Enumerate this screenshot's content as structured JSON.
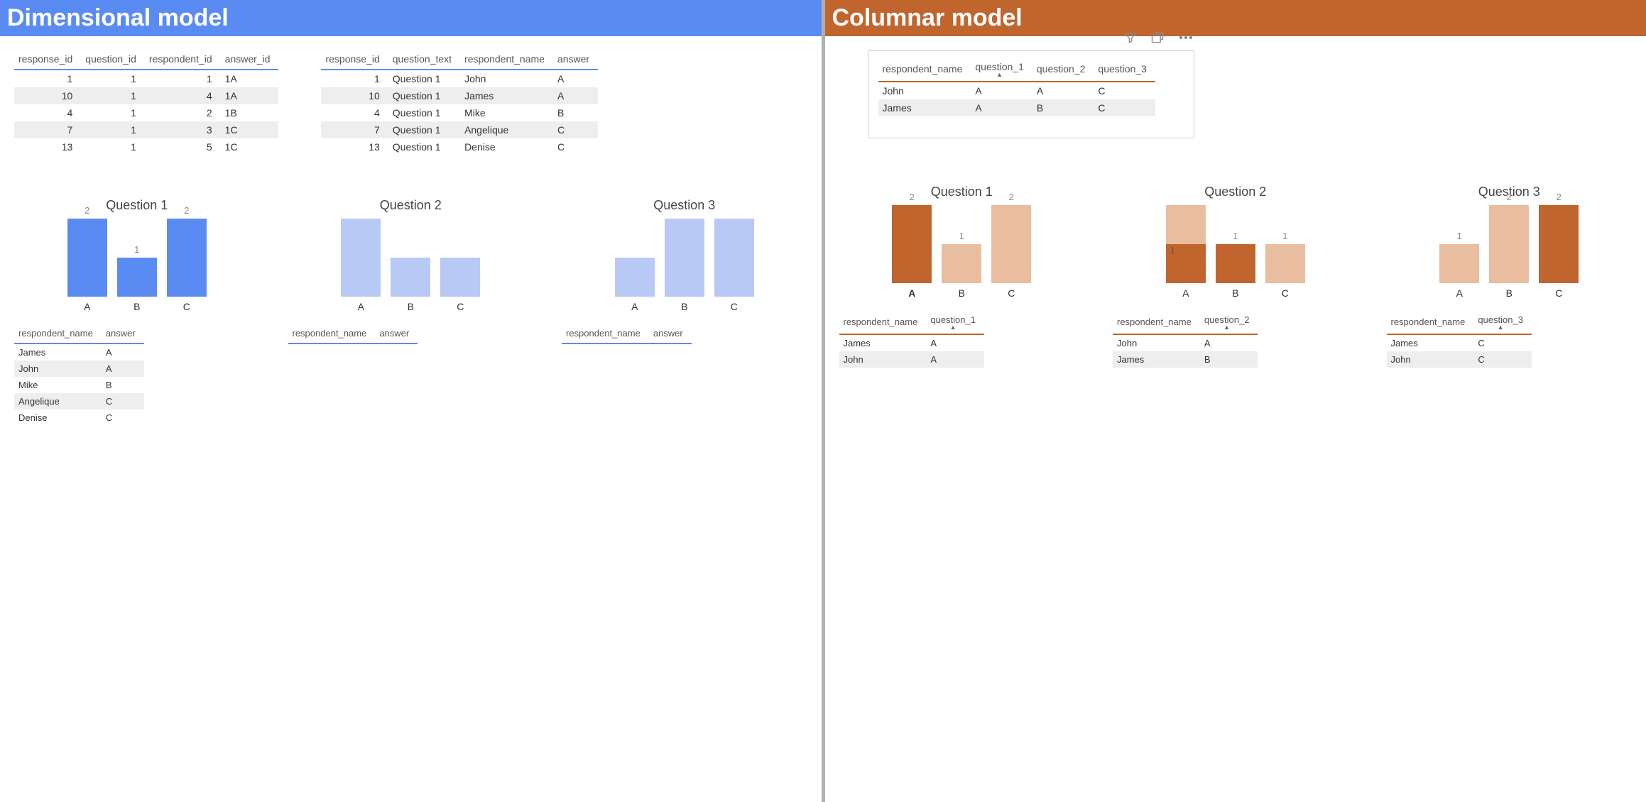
{
  "left": {
    "title": "Dimensional model",
    "headerColor": "#5a8bf2",
    "table1": {
      "headers": [
        "response_id",
        "question_id",
        "respondent_id",
        "answer_id"
      ],
      "rows": [
        [
          "1",
          "1",
          "1",
          "1A"
        ],
        [
          "10",
          "1",
          "4",
          "1A"
        ],
        [
          "4",
          "1",
          "2",
          "1B"
        ],
        [
          "7",
          "1",
          "3",
          "1C"
        ],
        [
          "13",
          "1",
          "5",
          "1C"
        ]
      ]
    },
    "table2": {
      "headers": [
        "response_id",
        "question_text",
        "respondent_name",
        "answer"
      ],
      "rows": [
        [
          "1",
          "Question 1",
          "John",
          "A"
        ],
        [
          "10",
          "Question 1",
          "James",
          "A"
        ],
        [
          "4",
          "Question 1",
          "Mike",
          "B"
        ],
        [
          "7",
          "Question 1",
          "Angelique",
          "C"
        ],
        [
          "13",
          "Question 1",
          "Denise",
          "C"
        ]
      ]
    },
    "charts": [
      {
        "title": "Question 1",
        "labels": [
          "A",
          "B",
          "C"
        ],
        "values": [
          2,
          1,
          2
        ],
        "showValues": true,
        "highlight": true,
        "colors": [
          "d",
          "d",
          "d"
        ],
        "subHeaders": [
          "respondent_name",
          "answer"
        ],
        "subRows": [
          [
            "James",
            "A"
          ],
          [
            "John",
            "A"
          ],
          [
            "Mike",
            "B"
          ],
          [
            "Angelique",
            "C"
          ],
          [
            "Denise",
            "C"
          ]
        ]
      },
      {
        "title": "Question 2",
        "labels": [
          "A",
          "B",
          "C"
        ],
        "values": [
          2,
          1,
          1
        ],
        "showValues": false,
        "highlight": false,
        "colors": [
          "l",
          "l",
          "l"
        ],
        "subHeaders": [
          "respondent_name",
          "answer"
        ],
        "subRows": []
      },
      {
        "title": "Question 3",
        "labels": [
          "A",
          "B",
          "C"
        ],
        "values": [
          1,
          2,
          2
        ],
        "showValues": false,
        "highlight": false,
        "colors": [
          "l",
          "l",
          "l"
        ],
        "subHeaders": [
          "respondent_name",
          "answer"
        ],
        "subRows": []
      }
    ]
  },
  "right": {
    "title": "Columnar model",
    "headerColor": "#c0652e",
    "toolbar": {
      "filter": "filter-icon",
      "focus": "focus-icon",
      "more": "more-icon"
    },
    "table": {
      "headers": [
        "respondent_name",
        "question_1",
        "question_2",
        "question_3"
      ],
      "sortedColumn": 1,
      "rows": [
        [
          "John",
          "A",
          "A",
          "C"
        ],
        [
          "James",
          "A",
          "B",
          "C"
        ]
      ]
    },
    "charts": [
      {
        "title": "Question 1",
        "labels": [
          "A",
          "B",
          "C"
        ],
        "values": [
          2,
          1,
          2
        ],
        "showValues": true,
        "colors": [
          "d",
          "l",
          "l"
        ],
        "boldLabel": "A",
        "subHeaders": [
          "respondent_name",
          "question_1"
        ],
        "sortedColumn": 1,
        "subRows": [
          [
            "James",
            "A"
          ],
          [
            "John",
            "A"
          ]
        ]
      },
      {
        "title": "Question 2",
        "labels": [
          "A",
          "B",
          "C"
        ],
        "values": [
          2,
          1,
          1
        ],
        "showValues": true,
        "colors": [
          "l",
          "d",
          "l"
        ],
        "overlayValues": {
          "0": 1
        },
        "subHeaders": [
          "respondent_name",
          "question_2"
        ],
        "sortedColumn": 1,
        "subRows": [
          [
            "John",
            "A"
          ],
          [
            "James",
            "B"
          ]
        ]
      },
      {
        "title": "Question 3",
        "labels": [
          "A",
          "B",
          "C"
        ],
        "values": [
          1,
          2,
          2
        ],
        "showValues": true,
        "colors": [
          "l",
          "l",
          "d"
        ],
        "subHeaders": [
          "respondent_name",
          "question_3"
        ],
        "sortedColumn": 1,
        "subRows": [
          [
            "James",
            "C"
          ],
          [
            "John",
            "C"
          ]
        ]
      }
    ]
  },
  "chart_data": [
    {
      "panel": "left",
      "title": "Question 1",
      "type": "bar",
      "categories": [
        "A",
        "B",
        "C"
      ],
      "values": [
        2,
        1,
        2
      ],
      "highlighted": true,
      "xlabel": "",
      "ylabel": "",
      "ylim": [
        0,
        2
      ]
    },
    {
      "panel": "left",
      "title": "Question 2",
      "type": "bar",
      "categories": [
        "A",
        "B",
        "C"
      ],
      "values": [
        2,
        1,
        1
      ],
      "highlighted": false,
      "xlabel": "",
      "ylabel": "",
      "ylim": [
        0,
        2
      ]
    },
    {
      "panel": "left",
      "title": "Question 3",
      "type": "bar",
      "categories": [
        "A",
        "B",
        "C"
      ],
      "values": [
        1,
        2,
        2
      ],
      "highlighted": false,
      "xlabel": "",
      "ylabel": "",
      "ylim": [
        0,
        2
      ]
    },
    {
      "panel": "right",
      "title": "Question 1",
      "type": "bar",
      "categories": [
        "A",
        "B",
        "C"
      ],
      "values": [
        2,
        1,
        2
      ],
      "highlight_category": "A",
      "xlabel": "",
      "ylabel": "",
      "ylim": [
        0,
        2
      ]
    },
    {
      "panel": "right",
      "title": "Question 2",
      "type": "bar",
      "categories": [
        "A",
        "B",
        "C"
      ],
      "values": [
        2,
        1,
        1
      ],
      "highlight_category": "B",
      "overlay": {
        "A": 1
      },
      "xlabel": "",
      "ylabel": "",
      "ylim": [
        0,
        2
      ]
    },
    {
      "panel": "right",
      "title": "Question 3",
      "type": "bar",
      "categories": [
        "A",
        "B",
        "C"
      ],
      "values": [
        1,
        2,
        2
      ],
      "highlight_category": "C",
      "xlabel": "",
      "ylabel": "",
      "ylim": [
        0,
        2
      ]
    }
  ]
}
